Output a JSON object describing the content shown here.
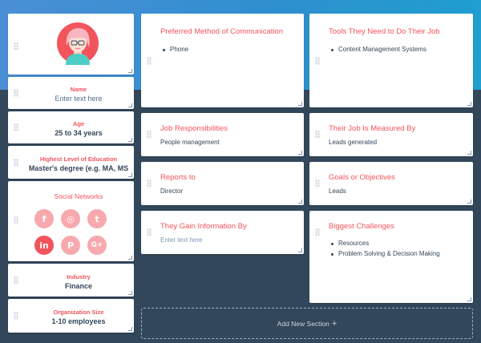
{
  "colors": {
    "accent": "#f2545b",
    "text": "#33475b",
    "background": "#33475b"
  },
  "left_panel": {
    "avatar": {
      "icon": "persona-avatar-icon"
    },
    "name": {
      "label": "Name",
      "placeholder": "Enter text here"
    },
    "age": {
      "label": "Age",
      "value": "25 to 34 years"
    },
    "education": {
      "label": "Highest Level of Education",
      "value": "Master's degree (e.g. MA, MS"
    },
    "social": {
      "label": "Social Networks",
      "networks": [
        {
          "name": "facebook",
          "glyph": "f",
          "active": false
        },
        {
          "name": "instagram",
          "glyph": "◎",
          "active": false
        },
        {
          "name": "twitter",
          "glyph": "t",
          "active": false
        },
        {
          "name": "linkedin",
          "glyph": "in",
          "active": true
        },
        {
          "name": "pinterest",
          "glyph": "P",
          "active": false
        },
        {
          "name": "google-plus",
          "glyph": "G+",
          "active": false
        }
      ]
    },
    "industry": {
      "label": "Industry",
      "value": "Finance"
    },
    "org_size": {
      "label": "Organization Size",
      "value": "1-10 employees"
    }
  },
  "sections": {
    "communication": {
      "title": "Preferred Method of Communication",
      "items": [
        "Phone"
      ]
    },
    "tools": {
      "title": "Tools They Need to Do Their Job",
      "items": [
        "Content Management Systems"
      ]
    },
    "responsibilities": {
      "title": "Job Responsibilities",
      "text": "People management"
    },
    "measured": {
      "title": "Their Job Is Measured By",
      "text": "Leads generated"
    },
    "reports_to": {
      "title": "Reports to",
      "text": "Director"
    },
    "goals": {
      "title": "Goals or Objectives",
      "text": "Leads"
    },
    "information": {
      "title": "They Gain Information By",
      "placeholder": "Enter text here"
    },
    "challenges": {
      "title": "Biggest Challenges",
      "items": [
        "Resources",
        "Problem Solving & Decision Making"
      ]
    }
  },
  "add_section": {
    "label": "Add New Section",
    "icon": "plus-icon"
  }
}
